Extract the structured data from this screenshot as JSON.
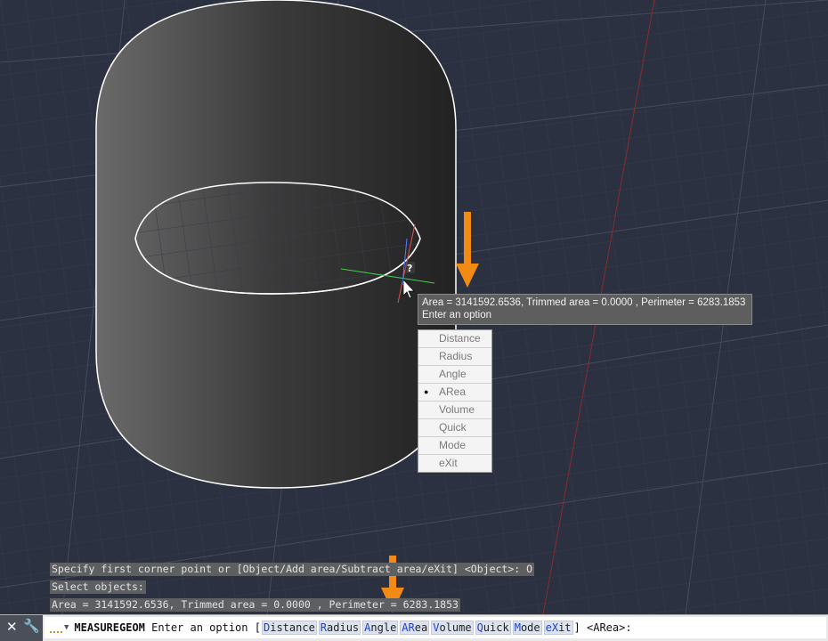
{
  "tooltip": {
    "line1": "Area = 3141592.6536, Trimmed area = 0.0000 , Perimeter = 6283.1853",
    "line2": "Enter an option"
  },
  "cursor_badge": "?",
  "menu": {
    "selected": "ARea",
    "items": [
      {
        "label": "Distance"
      },
      {
        "label": "Radius"
      },
      {
        "label": "Angle"
      },
      {
        "label": "ARea"
      },
      {
        "label": "Volume"
      },
      {
        "label": "Quick"
      },
      {
        "label": "Mode"
      },
      {
        "label": "eXit"
      }
    ]
  },
  "command_history": [
    "Specify first corner point or [Object/Add area/Subtract area/eXit] <Object>: O",
    "Select objects:",
    "Area = 3141592.6536, Trimmed area = 0.0000 , Perimeter = 6283.1853"
  ],
  "command_line": {
    "command": "MEASUREGEOM",
    "prompt": "Enter an option",
    "open_bracket": "[",
    "close_bracket": "]",
    "options": [
      {
        "hot": "D",
        "rest": "istance"
      },
      {
        "hot": "R",
        "rest": "adius"
      },
      {
        "hot": "A",
        "rest": "ngle"
      },
      {
        "hot": "AR",
        "rest": "ea"
      },
      {
        "hot": "V",
        "rest": "olume"
      },
      {
        "hot": "Q",
        "rest": "uick"
      },
      {
        "hot": "M",
        "rest": "ode"
      },
      {
        "hot": "eX",
        "rest": "it"
      }
    ],
    "default": "<ARea>:"
  },
  "icons": [
    "close-icon",
    "wrench-icon",
    "recent-commands-icon",
    "chevron-down-icon",
    "pointer-icon"
  ],
  "colors": {
    "background": "#2b3140",
    "annotation_arrow": "#f28a16",
    "option_hotkey": "#1e3fd0"
  }
}
